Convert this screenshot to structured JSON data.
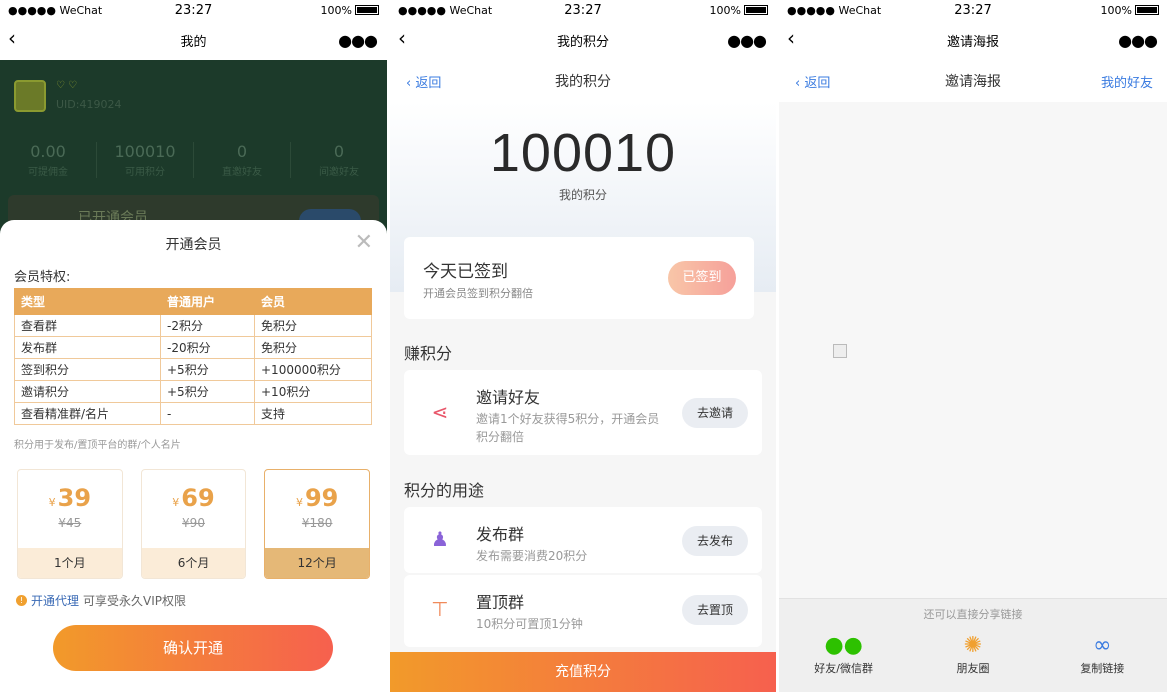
{
  "status": {
    "carrier": "●●●●● WeChat",
    "time": "23:27",
    "battery": "100%"
  },
  "p1": {
    "nav_title": "我的",
    "uid": "UID:419024",
    "stats": [
      {
        "value": "0.00",
        "label": "可提佣金"
      },
      {
        "value": "100010",
        "label": "可用积分"
      },
      {
        "value": "0",
        "label": "直邀好友"
      },
      {
        "value": "0",
        "label": "间邀好友"
      }
    ],
    "vip_bar_text": "已开通会员",
    "sheet_title": "开通会员",
    "privileges_label": "会员特权:",
    "table_headers": [
      "类型",
      "普通用户",
      "会员"
    ],
    "table_rows": [
      [
        "查看群",
        "-2积分",
        "免积分"
      ],
      [
        "发布群",
        "-20积分",
        "免积分"
      ],
      [
        "签到积分",
        "+5积分",
        "+100000积分"
      ],
      [
        "邀请积分",
        "+5积分",
        "+10积分"
      ],
      [
        "查看精准群/名片",
        "-",
        "支持"
      ]
    ],
    "note": "积分用于发布/置顶平台的群/个人名片",
    "plans": [
      {
        "currency": "¥",
        "price": "39",
        "old": "¥45",
        "duration": "1个月"
      },
      {
        "currency": "¥",
        "price": "69",
        "old": "¥90",
        "duration": "6个月"
      },
      {
        "currency": "¥",
        "price": "99",
        "old": "¥180",
        "duration": "12个月"
      }
    ],
    "agent_link": "开通代理",
    "agent_text": "可享受永久VIP权限",
    "confirm_button": "确认开通"
  },
  "p2": {
    "nav_title": "我的积分",
    "back": "返回",
    "title": "我的积分",
    "points": "100010",
    "points_label": "我的积分",
    "sign_title": "今天已签到",
    "sign_sub": "开通会员签到积分翻倍",
    "sign_button": "已签到",
    "earn_title": "赚积分",
    "invite": {
      "title": "邀请好友",
      "desc": "邀请1个好友获得5积分，开通会员积分翻倍",
      "button": "去邀请"
    },
    "use_title": "积分的用途",
    "publish": {
      "title": "发布群",
      "desc": "发布需要消费20积分",
      "button": "去发布"
    },
    "top": {
      "title": "置顶群",
      "desc": "10积分可置顶1分钟",
      "button": "去置顶"
    },
    "recharge": "充值积分"
  },
  "p3": {
    "nav_title": "邀请海报",
    "back": "返回",
    "title": "邀请海报",
    "friends": "我的好友",
    "share_tip": "还可以直接分享链接",
    "share": [
      {
        "label": "好友/微信群",
        "icon": "wechat-icon",
        "color": "#2dc100"
      },
      {
        "label": "朋友圈",
        "icon": "moments-icon",
        "color": "#f0a030"
      },
      {
        "label": "复制链接",
        "icon": "link-icon",
        "color": "#3a7be0"
      }
    ]
  }
}
